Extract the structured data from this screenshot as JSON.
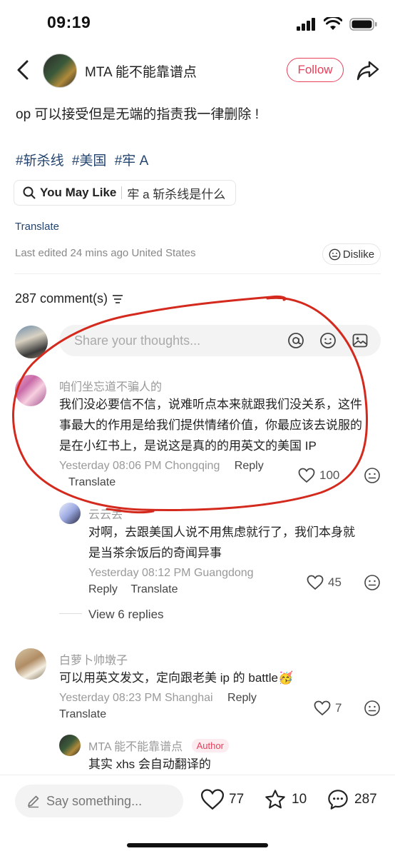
{
  "status_bar": {
    "time": "09:19"
  },
  "header": {
    "owner_name": "MTA 能不能靠谱点",
    "follow_label": "Follow"
  },
  "post": {
    "text": "op 可以接受但是无端的指责我一律删除 !",
    "hashtags": [
      "#斩杀线",
      "#美国",
      "#牢 A"
    ],
    "you_may_like_label": "You May Like",
    "you_may_like_query": "牢 a 斩杀线是什么",
    "translate_label": "Translate",
    "edited_text": "Last edited 24 mins ago United States",
    "dislike_label": "Dislike"
  },
  "comments_header": {
    "count_label": "287 comment(s)"
  },
  "comment_input": {
    "placeholder": "Share your thoughts..."
  },
  "comments": [
    {
      "user": "咱们坐忘道不骗人的",
      "lines": [
        "我们没必要信不信，说难听点本来就跟我们没关系，这件",
        "事最大的作用是给我们提供情绪价值，你最应该去说服的",
        "是在小红书上，是说这是真的的用英文的美国 IP"
      ],
      "meta": "Yesterday 08:06 PM Chongqing",
      "reply_label": "Reply",
      "translate_label": "Translate",
      "likes": "100"
    },
    {
      "user": "云云丢",
      "lines": [
        "对啊，去跟美国人说不用焦虑就行了，我们本身就",
        "是当茶余饭后的奇闻异事"
      ],
      "meta": "Yesterday 08:12 PM Guangdong",
      "reply_label": "Reply",
      "translate_label": "Translate",
      "likes": "45"
    },
    {
      "user": "白萝卜帅墩子",
      "lines": [
        "可以用英文发文，定向跟老美 ip 的 battle🥳"
      ],
      "meta": "Yesterday 08:23 PM Shanghai",
      "reply_label": "Reply",
      "translate_label": "Translate",
      "likes": "7"
    },
    {
      "user": "MTA 能不能靠谱点",
      "badge": "Author",
      "lines": [
        "其实 xhs 会自动翻译的"
      ]
    }
  ],
  "view_replies_label": "View 6 replies",
  "bottom_bar": {
    "say_placeholder": "Say something...",
    "likes": "77",
    "stars": "10",
    "comments": "287"
  },
  "colors": {
    "accent": "#e5405c",
    "hashtag": "#24456f",
    "annotation": "#d42a1e"
  }
}
